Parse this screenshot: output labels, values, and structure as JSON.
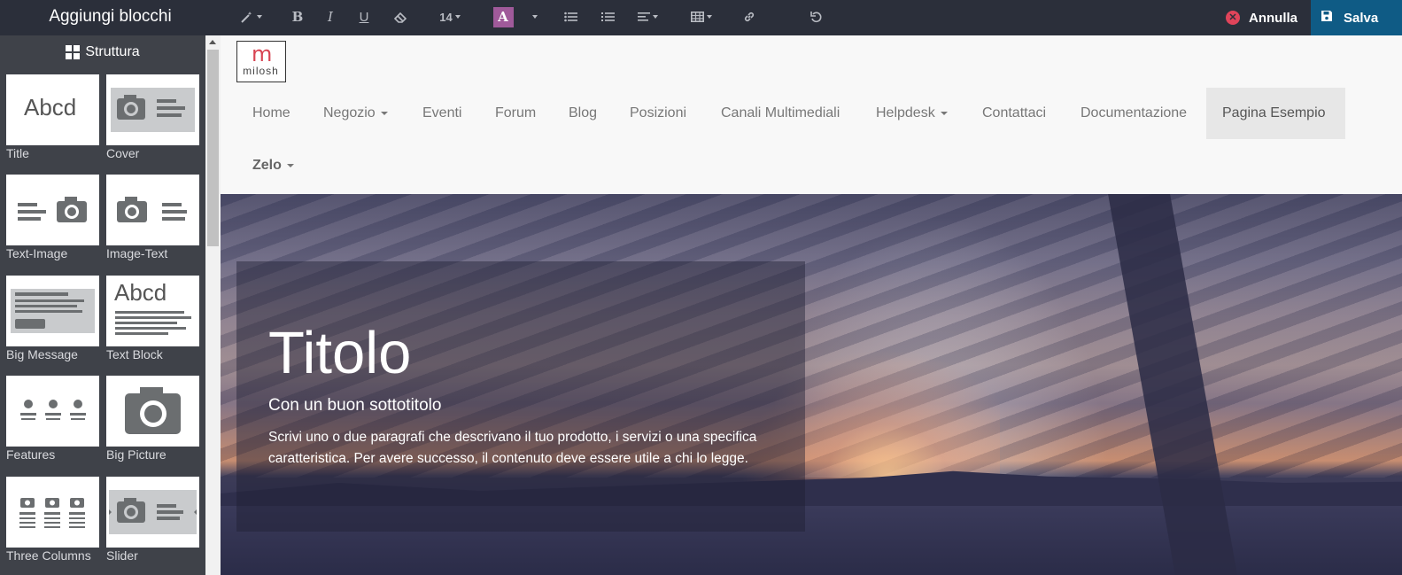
{
  "sidebar": {
    "title": "Aggiungi blocchi",
    "section": "Struttura",
    "blocks": [
      {
        "label": "Title"
      },
      {
        "label": "Cover"
      },
      {
        "label": "Text-Image"
      },
      {
        "label": "Image-Text"
      },
      {
        "label": "Big Message"
      },
      {
        "label": "Text Block"
      },
      {
        "label": "Features"
      },
      {
        "label": "Big Picture"
      },
      {
        "label": "Three Columns"
      },
      {
        "label": "Slider"
      }
    ],
    "title_thumb_text": "Abcd"
  },
  "toolbar": {
    "font_size": "14",
    "font_color_letter": "A",
    "font_color_accent": "#a05a9a",
    "cancel_label": "Annulla",
    "save_label": "Salva",
    "save_color": "#0f5b85"
  },
  "site": {
    "logo_letter": "m",
    "logo_text": "milosh",
    "nav": [
      {
        "label": "Home"
      },
      {
        "label": "Negozio"
      },
      {
        "label": "Eventi"
      },
      {
        "label": "Forum"
      },
      {
        "label": "Blog"
      },
      {
        "label": "Posizioni"
      },
      {
        "label": "Canali Multimediali"
      },
      {
        "label": "Helpdesk"
      },
      {
        "label": "Contattaci"
      },
      {
        "label": "Documentazione"
      },
      {
        "label": "Pagina Esempio"
      },
      {
        "label": "Zelo"
      }
    ],
    "hero": {
      "title": "Titolo",
      "subtitle": "Con un buon sottotitolo",
      "body": "Scrivi uno o due paragrafi che descrivano il tuo prodotto, i servizi o una specifica caratteristica. Per avere successo, il contenuto deve essere utile a chi lo legge."
    }
  }
}
